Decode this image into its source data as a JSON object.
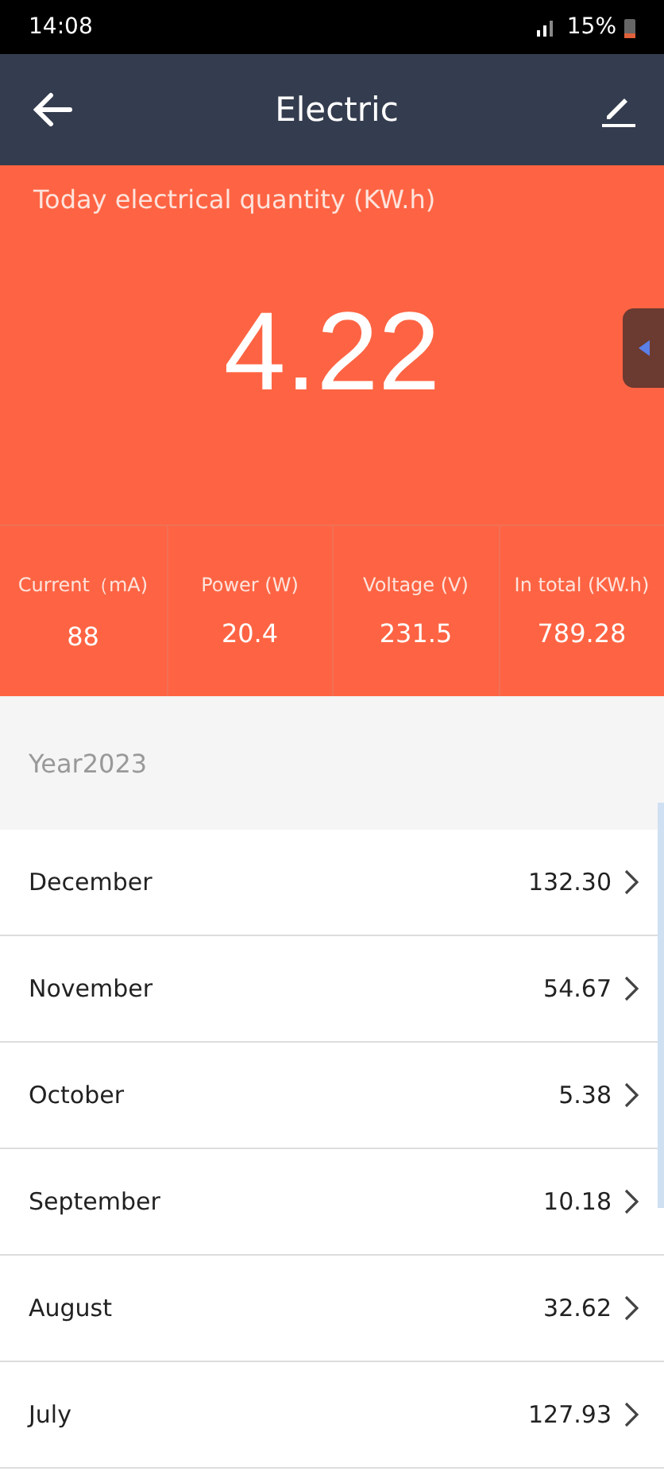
{
  "status_bar": {
    "time": "14:08",
    "battery": "15%"
  },
  "header": {
    "title": "Electric"
  },
  "today": {
    "label": "Today electrical quantity (KW.h)",
    "value": "4.22"
  },
  "stats": [
    {
      "label": "Current（mA)",
      "value": "88"
    },
    {
      "label": "Power (W)",
      "value": "20.4"
    },
    {
      "label": "Voltage (V)",
      "value": "231.5"
    },
    {
      "label": "In total (KW.h)",
      "value": "789.28"
    }
  ],
  "year": "Year2023",
  "months": [
    {
      "name": "December",
      "value": "132.30"
    },
    {
      "name": "November",
      "value": "54.67"
    },
    {
      "name": "October",
      "value": "5.38"
    },
    {
      "name": "September",
      "value": "10.18"
    },
    {
      "name": "August",
      "value": "32.62"
    },
    {
      "name": "July",
      "value": "127.93"
    }
  ]
}
